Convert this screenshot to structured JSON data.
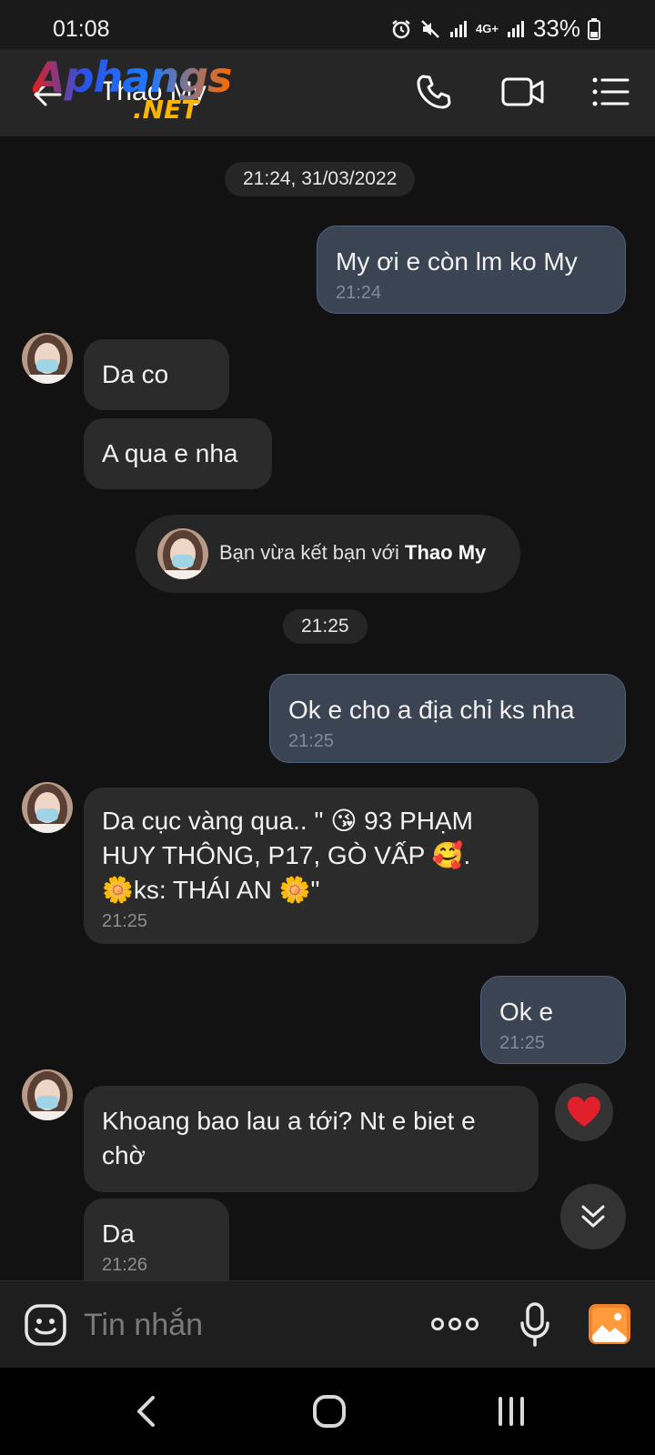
{
  "status_bar": {
    "time": "01:08",
    "network": "4G+",
    "battery": "33%"
  },
  "header": {
    "contact_name": "Thao My",
    "watermark_main": "Aphangs",
    "watermark_sub": ".NET"
  },
  "chat": {
    "date_separator_1": "21:24, 31/03/2022",
    "date_separator_2": "21:25",
    "messages": [
      {
        "direction": "out",
        "text": "My ơi e còn lm ko My",
        "time": "21:24"
      },
      {
        "direction": "in",
        "text": "Da co",
        "time": ""
      },
      {
        "direction": "in",
        "text": "A qua e nha",
        "time": ""
      },
      {
        "direction": "out",
        "text": "Ok e cho a địa chỉ ks nha",
        "time": "21:25"
      },
      {
        "direction": "in",
        "line1": "Da cục vàng qua.. \" 😘 93 PHẠM",
        "line2": "HUY THÔNG, P17, GÒ VẤP 🥰.",
        "line3": "🌼ks:   THÁI AN 🌼\"",
        "time": "21:25"
      },
      {
        "direction": "out",
        "text": "Ok e",
        "time": "21:25"
      },
      {
        "direction": "in",
        "line1": "Khoang bao lau a tới? Nt e biet e",
        "line2": "chờ",
        "time": ""
      },
      {
        "direction": "in",
        "text": "Da",
        "time": "21:26"
      }
    ],
    "friend_notice_prefix": "Bạn vừa kết bạn với ",
    "friend_notice_name": "Thao My"
  },
  "input_bar": {
    "placeholder": "Tin nhắn"
  },
  "colors": {
    "background": "#121212",
    "outgoing_bubble": "#3b4452",
    "incoming_bubble": "#2b2b2b",
    "reaction_heart": "#e0202a"
  },
  "icons": {
    "back": "back-arrow-icon",
    "call": "phone-icon",
    "video": "video-camera-icon",
    "menu": "menu-list-icon",
    "emoji": "smiley-icon",
    "more": "more-dots-icon",
    "mic": "microphone-icon",
    "image": "image-gallery-icon",
    "reaction": "heart-icon",
    "scroll": "double-chevron-down-icon"
  }
}
